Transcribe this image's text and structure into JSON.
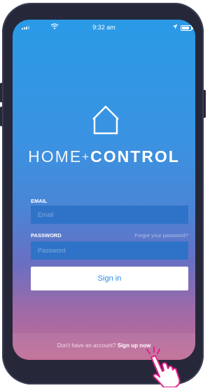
{
  "status_bar": {
    "time": "9:32 am"
  },
  "brand": {
    "part1": "HOME",
    "plus": "+",
    "part2": "CONTROL"
  },
  "form": {
    "email_label": "EMAIL",
    "email_placeholder": "Email",
    "password_label": "PASSWORD",
    "forgot_link": "Forgot your password?",
    "password_placeholder": "Password",
    "signin_button": "Sign in"
  },
  "footer": {
    "prompt": "Don't have an account?",
    "link": "Sign up now"
  },
  "colors": {
    "gradient_top": "#2a9ae6",
    "gradient_bottom": "#c26c94",
    "field_bg": "#2f73c8",
    "button_text": "#2d8be8",
    "hand_accent": "#e0218a"
  },
  "icons": [
    "signal-icon",
    "wifi-icon",
    "location-icon",
    "battery-icon",
    "home-icon",
    "tap-hand-icon"
  ]
}
